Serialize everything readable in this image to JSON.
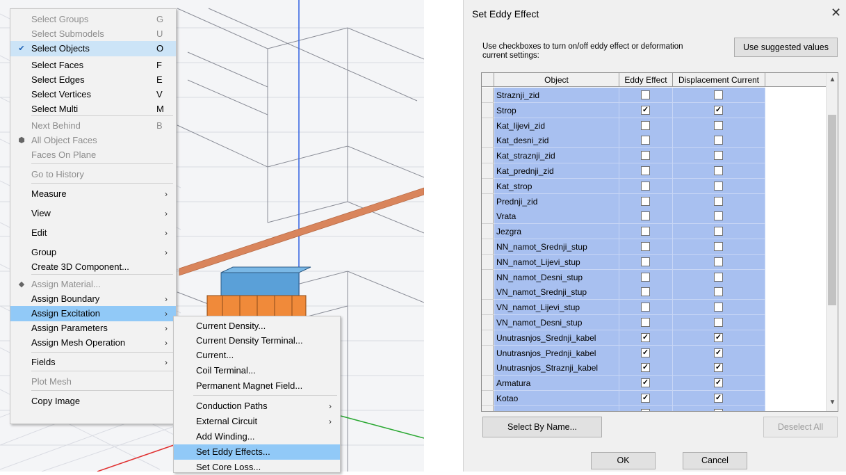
{
  "viewport": {
    "accent": "#3060e0"
  },
  "context_menu": {
    "items": [
      {
        "label": "Select Groups",
        "key": "G",
        "disabled": true
      },
      {
        "label": "Select Submodels",
        "key": "U",
        "disabled": true
      },
      {
        "label": "Select Objects",
        "key": "O",
        "checked": true
      },
      {
        "label": "Select Faces",
        "key": "F"
      },
      {
        "label": "Select Edges",
        "key": "E"
      },
      {
        "label": "Select Vertices",
        "key": "V"
      },
      {
        "label": "Select Multi",
        "key": "M"
      },
      {
        "label": "Next Behind",
        "key": "B",
        "disabled": true
      },
      {
        "label": "All Object Faces",
        "disabled": true
      },
      {
        "label": "Faces On Plane",
        "disabled": true
      },
      {
        "label": "Go to History",
        "disabled": true
      },
      {
        "label": "Measure"
      },
      {
        "label": "View"
      },
      {
        "label": "Edit"
      },
      {
        "label": "Group"
      },
      {
        "label": "Create 3D Component..."
      },
      {
        "label": "Assign Material...",
        "disabled": true
      },
      {
        "label": "Assign Boundary"
      },
      {
        "label": "Assign Excitation"
      },
      {
        "label": "Assign Parameters"
      },
      {
        "label": "Assign Mesh Operation"
      },
      {
        "label": "Fields"
      },
      {
        "label": "Plot Mesh",
        "disabled": true
      },
      {
        "label": "Copy Image"
      }
    ]
  },
  "submenu": {
    "items": [
      {
        "label": "Current Density..."
      },
      {
        "label": "Current Density Terminal..."
      },
      {
        "label": "Current..."
      },
      {
        "label": "Coil Terminal..."
      },
      {
        "label": "Permanent Magnet Field..."
      },
      {
        "label": "Conduction Paths"
      },
      {
        "label": "External Circuit"
      },
      {
        "label": "Add Winding..."
      },
      {
        "label": "Set Eddy Effects..."
      },
      {
        "label": "Set Core Loss..."
      }
    ]
  },
  "dialog": {
    "title": "Set Eddy Effect",
    "hint": "Use checkboxes to turn on/off eddy effect or deformation current settings:",
    "suggest_button": "Use suggested values",
    "columns": [
      "Object",
      "Eddy Effect",
      "Displacement Current"
    ],
    "rows": [
      {
        "name": "Straznji_zid",
        "eddy": false,
        "disp": false
      },
      {
        "name": "Strop",
        "eddy": true,
        "disp": true
      },
      {
        "name": "Kat_lijevi_zid",
        "eddy": false,
        "disp": false
      },
      {
        "name": "Kat_desni_zid",
        "eddy": false,
        "disp": false
      },
      {
        "name": "Kat_straznji_zid",
        "eddy": false,
        "disp": false
      },
      {
        "name": "Kat_prednji_zid",
        "eddy": false,
        "disp": false
      },
      {
        "name": "Kat_strop",
        "eddy": false,
        "disp": false
      },
      {
        "name": "Prednji_zid",
        "eddy": false,
        "disp": false
      },
      {
        "name": "Vrata",
        "eddy": false,
        "disp": false
      },
      {
        "name": "Jezgra",
        "eddy": false,
        "disp": false
      },
      {
        "name": "NN_namot_Srednji_stup",
        "eddy": false,
        "disp": false
      },
      {
        "name": "NN_namot_Lijevi_stup",
        "eddy": false,
        "disp": false
      },
      {
        "name": "NN_namot_Desni_stup",
        "eddy": false,
        "disp": false
      },
      {
        "name": "VN_namot_Srednji_stup",
        "eddy": false,
        "disp": false
      },
      {
        "name": "VN_namot_Lijevi_stup",
        "eddy": false,
        "disp": false
      },
      {
        "name": "VN_namot_Desni_stup",
        "eddy": false,
        "disp": false
      },
      {
        "name": "Unutrasnjos_Srednji_kabel",
        "eddy": true,
        "disp": true
      },
      {
        "name": "Unutrasnjos_Prednji_kabel",
        "eddy": true,
        "disp": true
      },
      {
        "name": "Unutrasnjos_Straznji_kabel",
        "eddy": true,
        "disp": true
      },
      {
        "name": "Armatura",
        "eddy": true,
        "disp": true
      },
      {
        "name": "Kotao",
        "eddy": true,
        "disp": true
      },
      {
        "name": "",
        "eddy": false,
        "disp": false
      }
    ],
    "select_by_name": "Select By Name...",
    "deselect_all": "Deselect All",
    "ok": "OK",
    "cancel": "Cancel",
    "selection_color": "#a8c0f0",
    "close_glyph": "✕"
  }
}
